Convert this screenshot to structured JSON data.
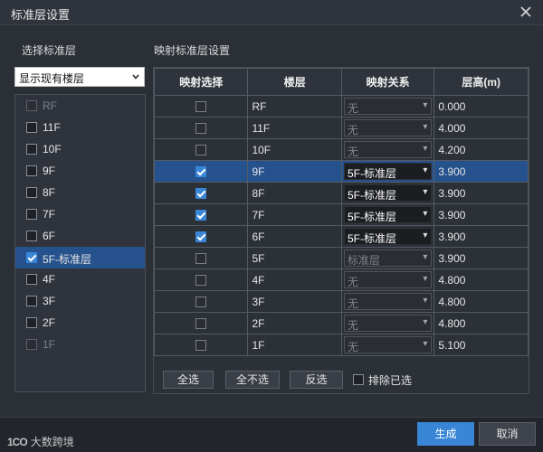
{
  "window": {
    "title": "标准层设置"
  },
  "left": {
    "section_label": "选择标准层",
    "select_value": "显示现有楼层",
    "floors": [
      {
        "label": "RF",
        "checked": false,
        "disabled": true,
        "selected": false
      },
      {
        "label": "11F",
        "checked": false,
        "disabled": false,
        "selected": false
      },
      {
        "label": "10F",
        "checked": false,
        "disabled": false,
        "selected": false
      },
      {
        "label": "9F",
        "checked": false,
        "disabled": false,
        "selected": false
      },
      {
        "label": "8F",
        "checked": false,
        "disabled": false,
        "selected": false
      },
      {
        "label": "7F",
        "checked": false,
        "disabled": false,
        "selected": false
      },
      {
        "label": "6F",
        "checked": false,
        "disabled": false,
        "selected": false
      },
      {
        "label": "5F-标准层",
        "checked": true,
        "disabled": false,
        "selected": true
      },
      {
        "label": "4F",
        "checked": false,
        "disabled": false,
        "selected": false
      },
      {
        "label": "3F",
        "checked": false,
        "disabled": false,
        "selected": false
      },
      {
        "label": "2F",
        "checked": false,
        "disabled": false,
        "selected": false
      },
      {
        "label": "1F",
        "checked": false,
        "disabled": true,
        "selected": false
      }
    ]
  },
  "right": {
    "section_label": "映射标准层设置",
    "columns": [
      "映射选择",
      "楼层",
      "映射关系",
      "层高(m)"
    ],
    "rows": [
      {
        "checked": false,
        "floor": "RF",
        "mapping": "无",
        "height": "0.000",
        "active": false,
        "selected": false
      },
      {
        "checked": false,
        "floor": "11F",
        "mapping": "无",
        "height": "4.000",
        "active": false,
        "selected": false
      },
      {
        "checked": false,
        "floor": "10F",
        "mapping": "无",
        "height": "4.200",
        "active": false,
        "selected": false
      },
      {
        "checked": true,
        "floor": "9F",
        "mapping": "5F-标准层",
        "height": "3.900",
        "active": true,
        "selected": true
      },
      {
        "checked": true,
        "floor": "8F",
        "mapping": "5F-标准层",
        "height": "3.900",
        "active": true,
        "selected": false
      },
      {
        "checked": true,
        "floor": "7F",
        "mapping": "5F-标准层",
        "height": "3.900",
        "active": true,
        "selected": false
      },
      {
        "checked": true,
        "floor": "6F",
        "mapping": "5F-标准层",
        "height": "3.900",
        "active": true,
        "selected": false
      },
      {
        "checked": false,
        "floor": "5F",
        "mapping": "标准层",
        "height": "3.900",
        "active": false,
        "selected": false
      },
      {
        "checked": false,
        "floor": "4F",
        "mapping": "无",
        "height": "4.800",
        "active": false,
        "selected": false
      },
      {
        "checked": false,
        "floor": "3F",
        "mapping": "无",
        "height": "4.800",
        "active": false,
        "selected": false
      },
      {
        "checked": false,
        "floor": "2F",
        "mapping": "无",
        "height": "4.800",
        "active": false,
        "selected": false
      },
      {
        "checked": false,
        "floor": "1F",
        "mapping": "无",
        "height": "5.100",
        "active": false,
        "selected": false
      }
    ],
    "buttons": {
      "select_all": "全选",
      "select_none": "全不选",
      "invert": "反选",
      "exclude_label": "排除已选"
    }
  },
  "footer": {
    "logo_mark": "1CO",
    "logo_text": "大数跨境",
    "ok": "生成",
    "cancel": "取消"
  },
  "colors": {
    "accent": "#3a86d6",
    "selection": "#25518c",
    "background": "#2b2f36"
  }
}
